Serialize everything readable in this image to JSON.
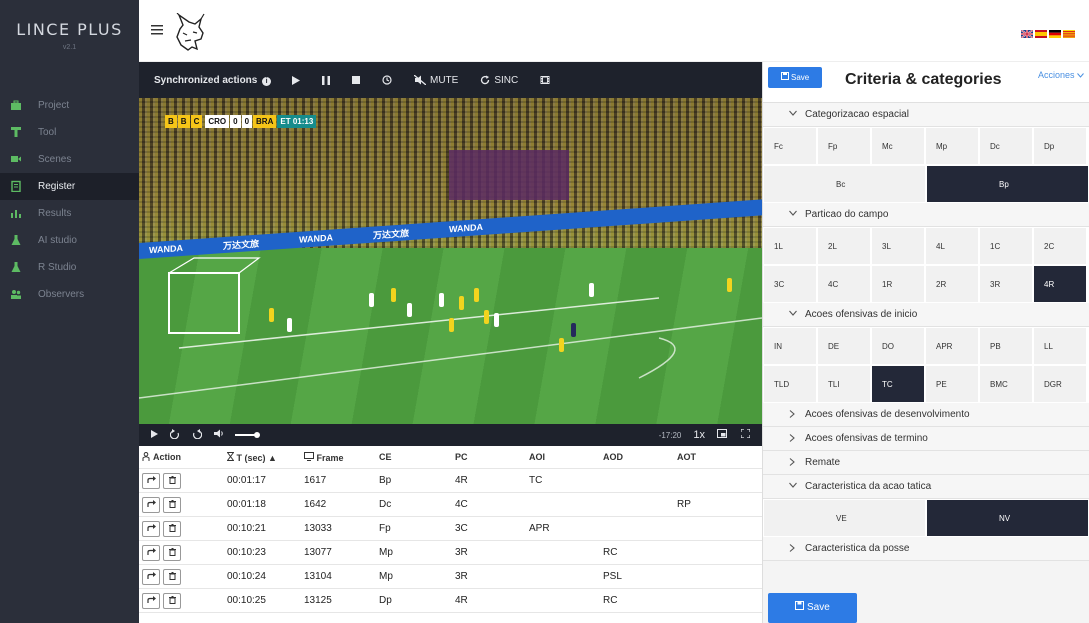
{
  "app": {
    "brand": "LINCE PLUS",
    "version": "v2.1"
  },
  "sidebar": {
    "items": [
      {
        "label": "Project",
        "icon": "briefcase-icon"
      },
      {
        "label": "Tool",
        "icon": "tool-icon"
      },
      {
        "label": "Scenes",
        "icon": "video-camera-icon"
      },
      {
        "label": "Register",
        "icon": "clipboard-icon"
      },
      {
        "label": "Results",
        "icon": "bar-chart-icon"
      },
      {
        "label": "AI studio",
        "icon": "flask-icon"
      },
      {
        "label": "R Studio",
        "icon": "flask-icon"
      },
      {
        "label": "Observers",
        "icon": "users-icon"
      }
    ],
    "active": "Register",
    "accent": "#5dbb63"
  },
  "video_toolbar": {
    "label": "Synchronized actions",
    "mute": "MUTE",
    "sinc": "SINC"
  },
  "scoreboard": {
    "letters": [
      "B",
      "B",
      "C"
    ],
    "team_a": "CRO",
    "score_a": "0",
    "score_b": "0",
    "team_b": "BRA",
    "time": "ET 01:13"
  },
  "ad_text": [
    "WANDA",
    "万达文旅",
    "WANDA",
    "万达文旅",
    "WANDA"
  ],
  "video_controls": {
    "time": "-17:20",
    "speed": "1x"
  },
  "table": {
    "headers": [
      "Action",
      "T (sec) ▲",
      "Frame",
      "CE",
      "PC",
      "AOI",
      "AOD",
      "AOT"
    ],
    "rows": [
      {
        "t": "00:01:17",
        "frame": "1617",
        "ce": "Bp",
        "pc": "4R",
        "aoi": "TC",
        "aod": "",
        "aot": ""
      },
      {
        "t": "00:01:18",
        "frame": "1642",
        "ce": "Dc",
        "pc": "4C",
        "aoi": "",
        "aod": "",
        "aot": "RP"
      },
      {
        "t": "00:10:21",
        "frame": "13033",
        "ce": "Fp",
        "pc": "3C",
        "aoi": "APR",
        "aod": "",
        "aot": ""
      },
      {
        "t": "00:10:23",
        "frame": "13077",
        "ce": "Mp",
        "pc": "3R",
        "aoi": "",
        "aod": "RC",
        "aot": ""
      },
      {
        "t": "00:10:24",
        "frame": "13104",
        "ce": "Mp",
        "pc": "3R",
        "aoi": "",
        "aod": "PSL",
        "aot": ""
      },
      {
        "t": "00:10:25",
        "frame": "13125",
        "ce": "Dp",
        "pc": "4R",
        "aoi": "",
        "aod": "RC",
        "aot": ""
      }
    ]
  },
  "right_panel": {
    "save": "Save",
    "title": "Criteria & categories",
    "acciones": "Acciones",
    "criteria": [
      {
        "name": "Categorizacao espacial",
        "open": true,
        "categories": [
          "Fc",
          "Fp",
          "Mc",
          "Mp",
          "Dc",
          "Dp",
          "Bc",
          "Bp"
        ],
        "selected": [
          "Bp"
        ]
      },
      {
        "name": "Particao do campo",
        "open": true,
        "categories": [
          "1L",
          "2L",
          "3L",
          "4L",
          "1C",
          "2C",
          "3C",
          "4C",
          "1R",
          "2R",
          "3R",
          "4R"
        ],
        "selected": [
          "4R"
        ]
      },
      {
        "name": "Acoes ofensivas de inicio",
        "open": true,
        "categories": [
          "IN",
          "DE",
          "DO",
          "APR",
          "PB",
          "LL",
          "TLD",
          "TLI",
          "TC",
          "PE",
          "BMC",
          "DGR"
        ],
        "selected": [
          "TC"
        ]
      },
      {
        "name": "Acoes ofensivas de desenvolvimento",
        "open": false,
        "categories": []
      },
      {
        "name": "Acoes ofensivas de termino",
        "open": false,
        "categories": []
      },
      {
        "name": "Remate",
        "open": false,
        "categories": []
      },
      {
        "name": "Caracteristica da acao tatica",
        "open": true,
        "categories": [
          "VE",
          "NV"
        ],
        "selected": [
          "NV"
        ]
      },
      {
        "name": "Caracteristica da posse",
        "open": false,
        "categories": []
      }
    ],
    "save_bottom": "Save",
    "accent": "#2d7be5",
    "selected_color": "#232838"
  }
}
